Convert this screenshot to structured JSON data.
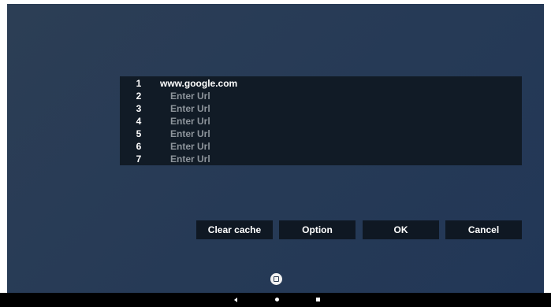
{
  "url_list": [
    {
      "number": "1",
      "value": "www.google.com",
      "is_placeholder": false
    },
    {
      "number": "2",
      "value": "Enter Url",
      "is_placeholder": true
    },
    {
      "number": "3",
      "value": "Enter Url",
      "is_placeholder": true
    },
    {
      "number": "4",
      "value": "Enter Url",
      "is_placeholder": true
    },
    {
      "number": "5",
      "value": "Enter Url",
      "is_placeholder": true
    },
    {
      "number": "6",
      "value": "Enter Url",
      "is_placeholder": true
    },
    {
      "number": "7",
      "value": "Enter Url",
      "is_placeholder": true
    }
  ],
  "buttons": {
    "clear_cache": "Clear cache",
    "option": "Option",
    "ok": "OK",
    "cancel": "Cancel"
  },
  "nav_icons": {
    "home_indicator": "square-in-circle-icon",
    "back": "back-triangle-icon",
    "home": "home-dot-icon",
    "recents": "recents-square-icon"
  },
  "colors": {
    "background": "#263a56",
    "panel": "#111b26",
    "button": "#0f1823",
    "text": "#ffffff",
    "placeholder": "#8d949b",
    "navbar": "#000000"
  }
}
